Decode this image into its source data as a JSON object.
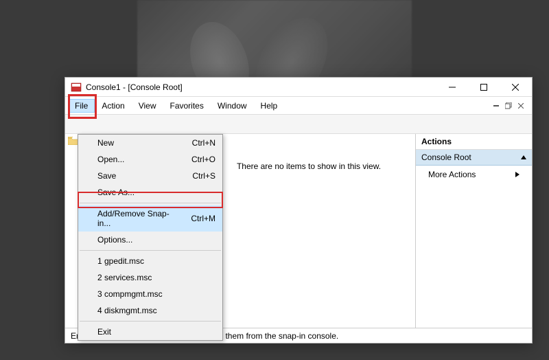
{
  "window": {
    "title": "Console1 - [Console Root]"
  },
  "menubar": {
    "items": [
      "File",
      "Action",
      "View",
      "Favorites",
      "Window",
      "Help"
    ]
  },
  "file_menu": {
    "new": {
      "label": "New",
      "shortcut": "Ctrl+N"
    },
    "open": {
      "label": "Open...",
      "shortcut": "Ctrl+O"
    },
    "save": {
      "label": "Save",
      "shortcut": "Ctrl+S"
    },
    "save_as": {
      "label": "Save As...",
      "shortcut": ""
    },
    "add_remove": {
      "label": "Add/Remove Snap-in...",
      "shortcut": "Ctrl+M"
    },
    "options": {
      "label": "Options...",
      "shortcut": ""
    },
    "recent": [
      "1 gpedit.msc",
      "2 services.msc",
      "3 compmgmt.msc",
      "4 diskmgmt.msc"
    ],
    "exit": {
      "label": "Exit",
      "shortcut": ""
    }
  },
  "center": {
    "empty_message": "There are no items to show in this view."
  },
  "actions": {
    "header": "Actions",
    "section": "Console Root",
    "more": "More Actions"
  },
  "statusbar": {
    "text": "Enables you to add snap-ins to or remove them from the snap-in console."
  }
}
